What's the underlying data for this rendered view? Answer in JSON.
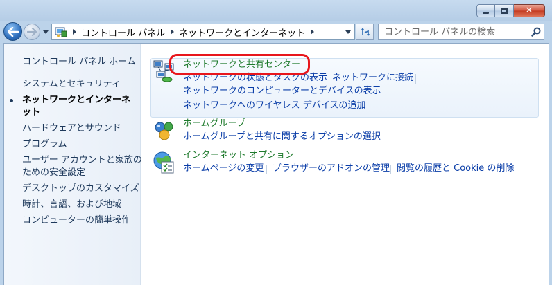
{
  "window": {
    "minimize_glyph": "",
    "close_glyph": "✕"
  },
  "address": {
    "crumbs": [
      "コントロール パネル",
      "ネットワークとインターネット"
    ]
  },
  "search": {
    "placeholder": "コントロール パネルの検索"
  },
  "sidebar": {
    "items": [
      {
        "label": "コントロール パネル ホーム"
      },
      {
        "label": "システムとセキュリティ"
      },
      {
        "label_line1": "ネットワークとインターネ",
        "label_line2": "ット",
        "current": true
      },
      {
        "label": "ハードウェアとサウンド"
      },
      {
        "label": "プログラム"
      },
      {
        "label_line1": "ユーザー アカウントと家族の",
        "label_line2": "ための安全設定"
      },
      {
        "label": "デスクトップのカスタマイズ"
      },
      {
        "label": "時計、言語、および地域"
      },
      {
        "label": "コンピューターの簡単操作"
      }
    ]
  },
  "categories": [
    {
      "title": "ネットワークと共有センター",
      "icon": "network-sharing-icon",
      "links": [
        "ネットワークの状態とタスクの表示",
        "ネットワークに接続",
        "ネットワークのコンピューターとデバイスの表示",
        "ネットワークへのワイヤレス デバイスの追加"
      ]
    },
    {
      "title": "ホームグループ",
      "icon": "homegroup-icon",
      "links": [
        "ホームグループと共有に関するオプションの選択"
      ]
    },
    {
      "title": "インターネット オプション",
      "icon": "internet-options-icon",
      "links": [
        "ホームページの変更",
        "ブラウザーのアドオンの管理",
        "閲覧の履歴と Cookie の削除"
      ]
    }
  ],
  "colors": {
    "link": "#0b3ea8",
    "category_title": "#1e7a2c",
    "highlight": "#e8161c"
  }
}
